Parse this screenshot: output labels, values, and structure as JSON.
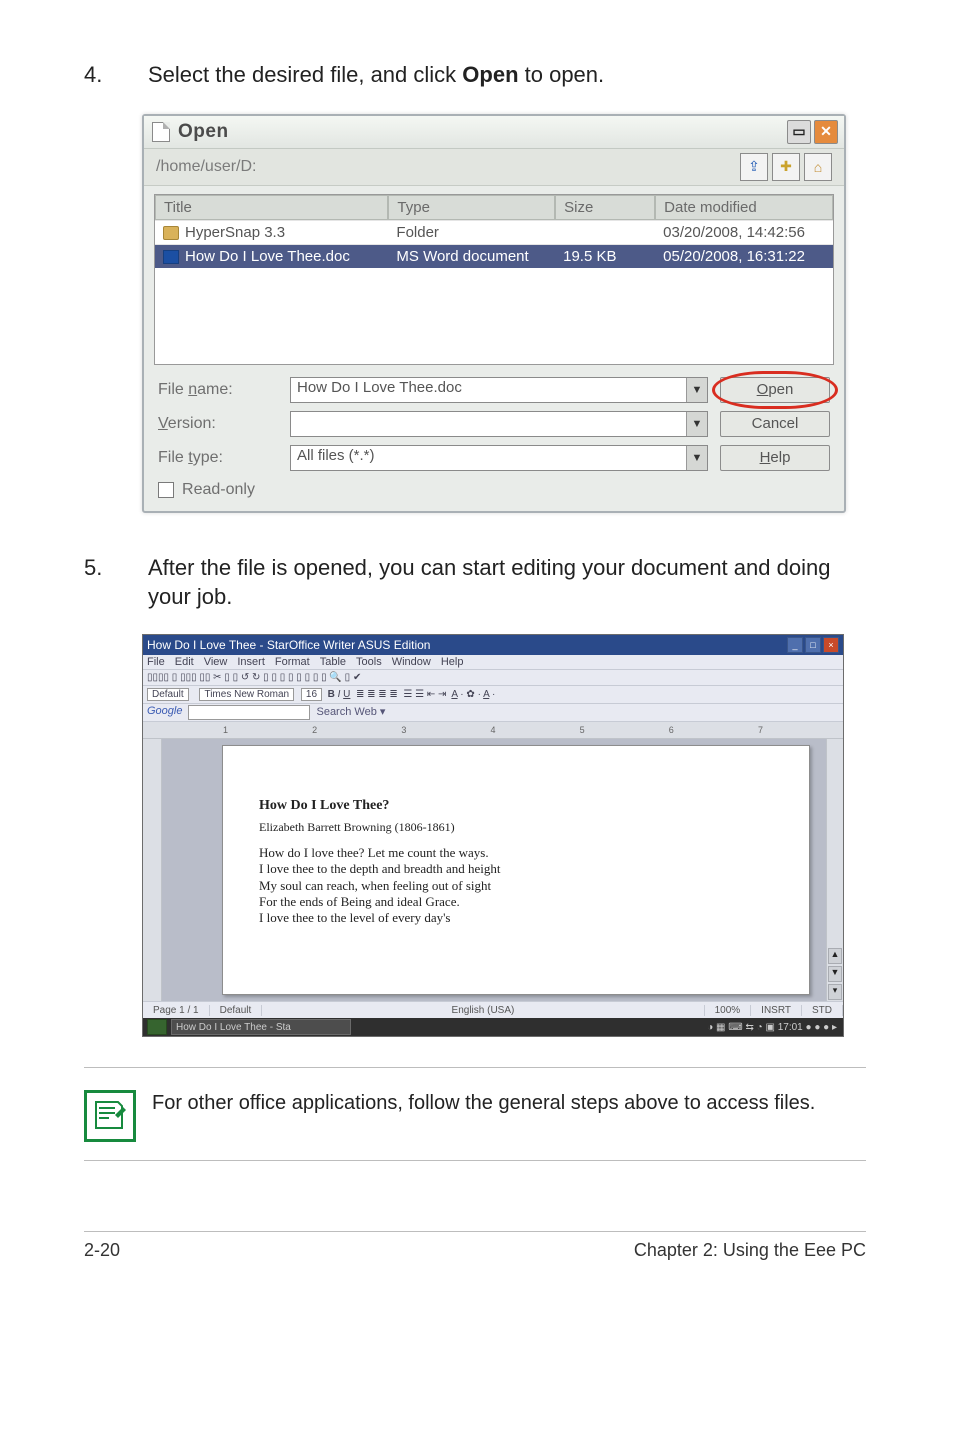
{
  "steps": {
    "s4_num": "4.",
    "s4_text_a": "Select the desired file, and click ",
    "s4_bold": "Open",
    "s4_text_b": " to open.",
    "s5_num": "5.",
    "s5_text": "After the file is opened, you can start editing your document and doing your job."
  },
  "open_dialog": {
    "title": "Open",
    "path": "/home/user/D:",
    "headers": {
      "title": "Title",
      "type": "Type",
      "size": "Size",
      "date": "Date modified"
    },
    "rows": [
      {
        "title": "HyperSnap 3.3",
        "type": "Folder",
        "size": "",
        "date": "03/20/2008, 14:42:56",
        "icon": "folder",
        "selected": false
      },
      {
        "title": "How Do I Love Thee.doc",
        "type": "MS Word document",
        "size": "19.5 KB",
        "date": "05/20/2008, 16:31:22",
        "icon": "doc",
        "selected": true
      }
    ],
    "labels": {
      "file_name": "File name:",
      "version": "Version:",
      "file_type": "File type:",
      "read_only": "Read-only"
    },
    "file_name_value": "How Do I Love Thee.doc",
    "version_value": "",
    "file_type_value": "All files (*.*)",
    "buttons": {
      "open": "Open",
      "cancel": "Cancel",
      "help": "Help"
    }
  },
  "writer": {
    "title": "How Do I Love Thee - StarOffice Writer ASUS Edition",
    "menu": [
      "File",
      "Edit",
      "View",
      "Insert",
      "Format",
      "Table",
      "Tools",
      "Window",
      "Help"
    ],
    "style": "Default",
    "font": "Times New Roman",
    "size": "16",
    "google": "Google",
    "search_hint": "Search Web",
    "ruler": [
      "1",
      "2",
      "3",
      "4",
      "5",
      "6",
      "7"
    ],
    "doc_heading": "How Do I Love Thee?",
    "doc_author": "Elizabeth Barrett Browning (1806-1861)",
    "doc_lines": [
      "How do I love thee? Let me count the ways.",
      "I love thee to the depth and breadth and height",
      "My soul can reach, when feeling out of sight",
      "For the ends of Being and ideal Grace.",
      "I love thee to the level of every day's"
    ],
    "status": {
      "page": "Page 1 / 1",
      "style": "Default",
      "lang": "English (USA)",
      "zoom": "100%",
      "ins": "INSRT",
      "std": "STD"
    },
    "tray": {
      "task": "How Do I Love Thee - Sta",
      "time": "17:01"
    }
  },
  "note": "For other office applications, follow the general steps above to access files.",
  "footer": {
    "left": "2-20",
    "right": "Chapter 2: Using the Eee PC"
  }
}
